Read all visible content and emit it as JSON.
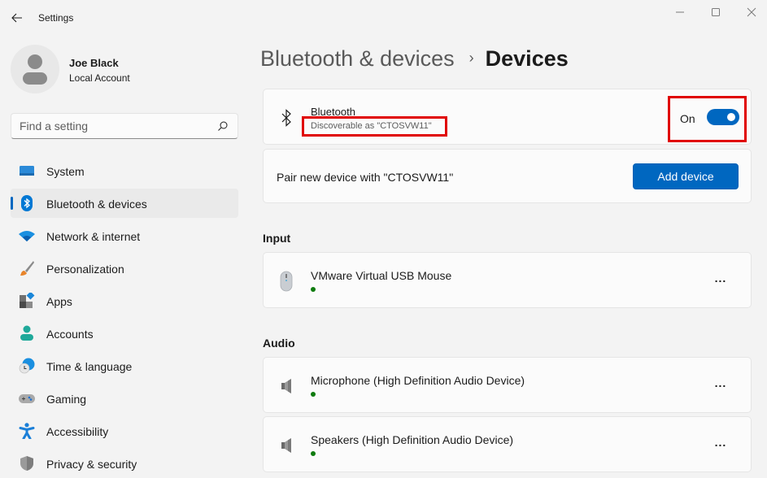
{
  "window": {
    "title": "Settings",
    "controls": [
      "minimize",
      "maximize",
      "close"
    ]
  },
  "profile": {
    "name": "Joe Black",
    "account_type": "Local Account"
  },
  "search": {
    "placeholder": "Find a setting",
    "value": ""
  },
  "sidebar": {
    "items": [
      {
        "label": "System",
        "icon": "system-icon",
        "active": false
      },
      {
        "label": "Bluetooth & devices",
        "icon": "bluetooth-icon",
        "active": true
      },
      {
        "label": "Network & internet",
        "icon": "wifi-icon",
        "active": false
      },
      {
        "label": "Personalization",
        "icon": "brush-icon",
        "active": false
      },
      {
        "label": "Apps",
        "icon": "apps-icon",
        "active": false
      },
      {
        "label": "Accounts",
        "icon": "accounts-icon",
        "active": false
      },
      {
        "label": "Time & language",
        "icon": "time-language-icon",
        "active": false
      },
      {
        "label": "Gaming",
        "icon": "gamepad-icon",
        "active": false
      },
      {
        "label": "Accessibility",
        "icon": "accessibility-icon",
        "active": false
      },
      {
        "label": "Privacy & security",
        "icon": "shield-icon",
        "active": false
      }
    ]
  },
  "breadcrumb": {
    "parent": "Bluetooth & devices",
    "separator": "›",
    "current": "Devices"
  },
  "bluetooth": {
    "title": "Bluetooth",
    "subtitle": "Discoverable as \"CTOSVW11\"",
    "toggle_label": "On",
    "toggle_on": true
  },
  "pair": {
    "label": "Pair new device with \"CTOSVW11\"",
    "button": "Add device"
  },
  "sections": {
    "input": {
      "title": "Input",
      "devices": [
        {
          "name": "VMware Virtual USB Mouse",
          "icon": "mouse-icon",
          "status": "connected",
          "more": "..."
        }
      ]
    },
    "audio": {
      "title": "Audio",
      "devices": [
        {
          "name": "Microphone (High Definition Audio Device)",
          "icon": "speaker-icon",
          "status": "connected",
          "more": "..."
        },
        {
          "name": "Speakers (High Definition Audio Device)",
          "icon": "speaker-icon",
          "status": "connected",
          "more": "..."
        }
      ]
    }
  },
  "colors": {
    "accent": "#0067c0",
    "highlight_box": "#e00000",
    "status_connected": "#0f7b0f",
    "background": "#f3f3f3",
    "card": "#fbfbfb"
  }
}
